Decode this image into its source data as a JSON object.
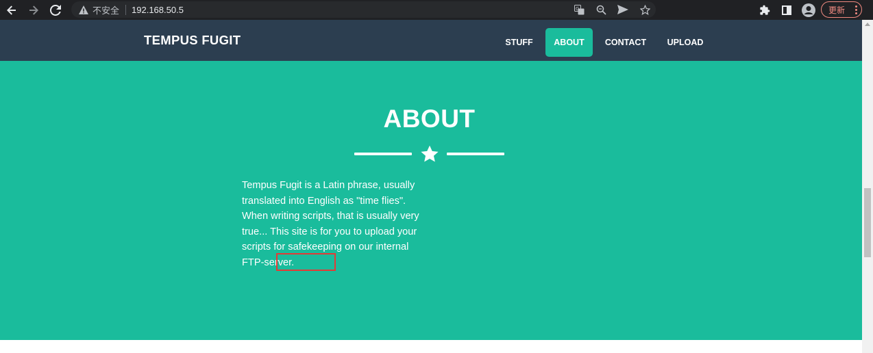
{
  "browser": {
    "security_label": "不安全",
    "url": "192.168.50.5",
    "update_label": "更新",
    "icons": [
      "back-icon",
      "forward-icon",
      "reload-icon",
      "warning-icon",
      "translate-icon",
      "zoom-icon",
      "send-icon",
      "bookmark-star-icon",
      "extensions-icon",
      "side-panel-icon",
      "profile-icon",
      "menu-dots-icon"
    ]
  },
  "site": {
    "brand": "TEMPUS FUGIT",
    "nav": [
      {
        "label": "STUFF"
      },
      {
        "label": "ABOUT",
        "active": true
      },
      {
        "label": "CONTACT"
      },
      {
        "label": "UPLOAD"
      }
    ],
    "about": {
      "title": "ABOUT",
      "text_before": "Tempus Fugit is a Latin phrase, usually translated into English as \"time flies\". When writing scripts, that is usually very true... This site is for you to upload your scripts for safekeeping on our internal ",
      "text_highlight": "FTP-server."
    }
  },
  "colors": {
    "nav_bg": "#2c3e50",
    "accent": "#1abc9c",
    "highlight_border": "#e53935"
  }
}
